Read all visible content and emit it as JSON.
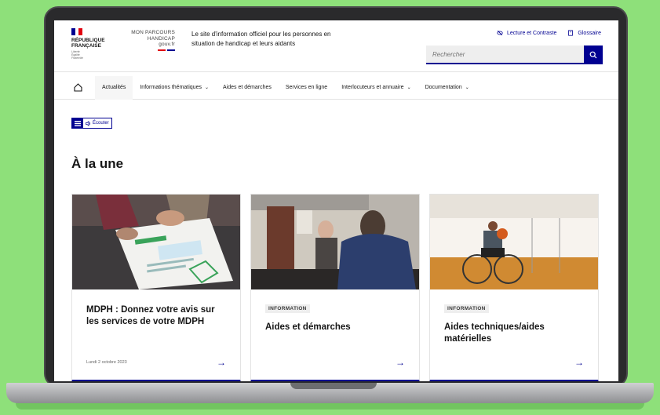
{
  "header": {
    "rf_title": "RÉPUBLIQUE\nFRANÇAISE",
    "rf_motto": "Liberté\nÉgalité\nFraternité",
    "mpc_line1": "MON PARCOURS",
    "mpc_line2": "HANDICAP",
    "mpc_line3": "gouv.fr",
    "tagline": "Le site d'information officiel pour les personnes en situation de handicap et leurs aidants",
    "contrast_link": "Lecture et Contraste",
    "glossary_link": "Glossaire",
    "search_placeholder": "Rechercher"
  },
  "nav": {
    "items": [
      {
        "label": "Actualités",
        "dropdown": false
      },
      {
        "label": "Informations thématiques",
        "dropdown": true
      },
      {
        "label": "Aides et démarches",
        "dropdown": false
      },
      {
        "label": "Services en ligne",
        "dropdown": false
      },
      {
        "label": "Interlocuteurs et annuaire",
        "dropdown": true
      },
      {
        "label": "Documentation",
        "dropdown": true
      }
    ]
  },
  "tools": {
    "listen_label": "Écouter"
  },
  "section_title": "À la une",
  "cards": [
    {
      "badge": "",
      "title": "MDPH : Donnez votre avis sur les services de votre MDPH",
      "date": "Lundi 2 octobre 2023",
      "image": "form-review-photo"
    },
    {
      "badge": "INFORMATION",
      "title": "Aides et démarches",
      "date": "",
      "image": "office-meeting-photo"
    },
    {
      "badge": "INFORMATION",
      "title": "Aides techniques/aides matérielles",
      "date": "",
      "image": "wheelchair-basketball-photo"
    }
  ],
  "colors": {
    "brand_blue": "#000091",
    "marianne_red": "#e1000f",
    "background_green": "#8ee07a"
  }
}
